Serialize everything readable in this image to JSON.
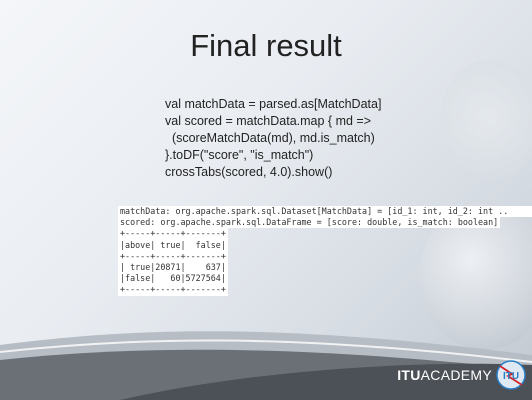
{
  "slide": {
    "title": "Final result",
    "code_lines": [
      "val matchData = parsed.as[MatchData]",
      "val scored = matchData.map { md =>",
      "  (scoreMatchData(md), md.is_match)",
      "}.toDF(\"score\", \"is_match\")",
      "crossTabs(scored, 4.0).show()"
    ],
    "console": {
      "line1": "matchData: org.apache.spark.sql.Dataset[MatchData] = [id_1: int, id_2: int ..",
      "line2": "scored: org.apache.spark.sql.DataFrame = [score: double, is_match: boolean]",
      "table": [
        "+-----+-----+-------+",
        "|above| true|  false|",
        "+-----+-----+-------+",
        "| true|20871|    637|",
        "|false|   60|5727564|",
        "+-----+-----+-------+"
      ]
    },
    "logo": {
      "bold": "ITU",
      "rest": "ACADEMY",
      "emblem": "ITU"
    }
  },
  "colors": {
    "swoosh": "#5a5f66",
    "logo_blue": "#2a7fc4",
    "logo_red": "#d0262b"
  }
}
